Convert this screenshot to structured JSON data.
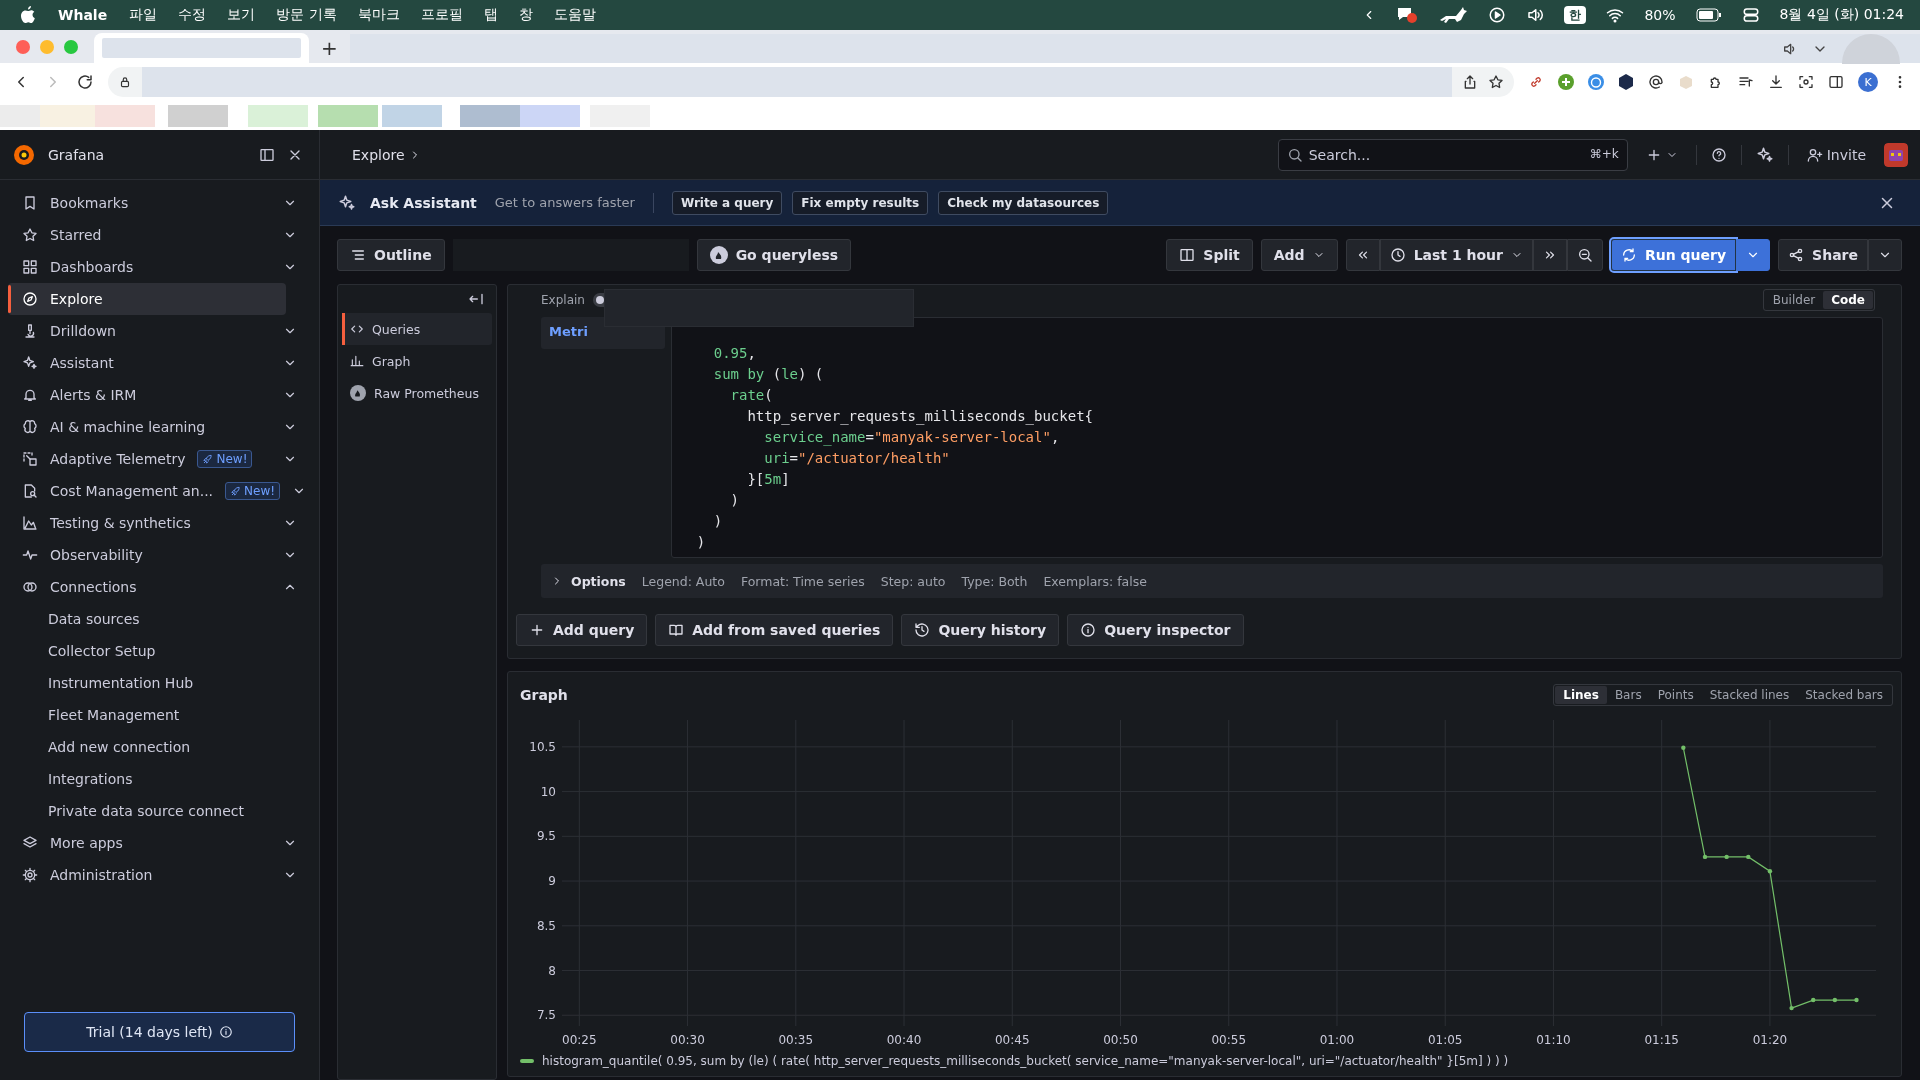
{
  "menubar": {
    "app": "Whale",
    "menus": [
      "파일",
      "수정",
      "보기",
      "방문 기록",
      "북마크",
      "프로필",
      "탭",
      "창",
      "도움말"
    ],
    "ime": "한",
    "battery": "80%",
    "clock": "8월 4일 (화) 01:24"
  },
  "browser": {
    "new_tab": "+",
    "profile": "K"
  },
  "header": {
    "breadcrumb": "Explore",
    "search": {
      "placeholder": "Search..."
    },
    "shortcut": "⌘+k",
    "invite": "Invite"
  },
  "sidebar": {
    "brand": "Grafana",
    "items": [
      {
        "label": "Bookmarks",
        "selected": false,
        "expanded": false
      },
      {
        "label": "Starred",
        "selected": false,
        "expanded": false
      },
      {
        "label": "Dashboards",
        "selected": false,
        "expanded": false
      },
      {
        "label": "Explore",
        "selected": true
      },
      {
        "label": "Drilldown",
        "selected": false,
        "expanded": false
      },
      {
        "label": "Assistant",
        "selected": false,
        "expanded": false
      },
      {
        "label": "Alerts & IRM",
        "selected": false,
        "expanded": false
      },
      {
        "label": "AI & machine learning",
        "selected": false,
        "expanded": false
      },
      {
        "label": "Adaptive Telemetry",
        "badge": "New!",
        "selected": false,
        "expanded": false
      },
      {
        "label": "Cost Management an...",
        "badge": "New!",
        "selected": false,
        "expanded": false
      },
      {
        "label": "Testing & synthetics",
        "selected": false,
        "expanded": false
      },
      {
        "label": "Observability",
        "selected": false,
        "expanded": false
      },
      {
        "label": "Connections",
        "selected": false,
        "expanded": true,
        "children": [
          {
            "label": "Data sources",
            "selected": false
          },
          {
            "label": "Collector Setup",
            "selected": false
          },
          {
            "label": "Instrumentation Hub",
            "selected": false
          },
          {
            "label": "Fleet Management",
            "selected": false
          },
          {
            "label": "Add new connection",
            "selected": false
          },
          {
            "label": "Integrations",
            "selected": false
          },
          {
            "label": "Private data source connect",
            "selected": false
          }
        ]
      },
      {
        "label": "More apps",
        "selected": false,
        "expanded": false
      },
      {
        "label": "Administration",
        "selected": false,
        "expanded": false
      }
    ],
    "trial": "Trial (14 days left)"
  },
  "banner": {
    "title": "Ask Assistant",
    "hint": "Get to answers faster",
    "actions": [
      "Write a query",
      "Fix empty results",
      "Check my datasources"
    ]
  },
  "toolbar": {
    "outline": "Outline",
    "queryless": "Go queryless",
    "split": "Split",
    "add": "Add",
    "time_range": "Last 1 hour",
    "run": "Run query",
    "share": "Share"
  },
  "outline": {
    "items": [
      {
        "label": "Queries",
        "selected": true
      },
      {
        "label": "Graph",
        "selected": false
      },
      {
        "label": "Raw Prometheus",
        "selected": false
      }
    ]
  },
  "query": {
    "explain": "Explain",
    "explain_on": false,
    "metric_tab": "Metri",
    "modes": [
      {
        "label": "Builder",
        "selected": false
      },
      {
        "label": "Code",
        "selected": true
      }
    ],
    "code": [
      {
        "children": [
          {
            "tokens": [
              {
                "kind": "num",
                "text": "0.95"
              },
              {
                "kind": "plain",
                "text": ","
              }
            ]
          },
          {
            "tokens": [
              {
                "kind": "fn",
                "text": "sum by"
              },
              {
                "kind": "plain",
                "text": " ("
              },
              {
                "kind": "fn",
                "text": "le"
              },
              {
                "kind": "plain",
                "text": ") ("
              }
            ],
            "children": [
              {
                "tokens": [
                  {
                    "kind": "fn",
                    "text": "rate"
                  },
                  {
                    "kind": "plain",
                    "text": "("
                  }
                ],
                "children": [
                  {
                    "tokens": [
                      {
                        "kind": "plain",
                        "text": "http_server_requests_milliseconds_bucket{"
                      }
                    ],
                    "children": [
                      {
                        "tokens": [
                          {
                            "kind": "fn",
                            "text": "service_name"
                          },
                          {
                            "kind": "plain",
                            "text": "="
                          },
                          {
                            "kind": "str",
                            "text": "\"manyak-server-local\""
                          },
                          {
                            "kind": "plain",
                            "text": ","
                          }
                        ]
                      },
                      {
                        "tokens": [
                          {
                            "kind": "fn",
                            "text": "uri"
                          },
                          {
                            "kind": "plain",
                            "text": "="
                          },
                          {
                            "kind": "str",
                            "text": "\"/actuator/health\""
                          }
                        ]
                      }
                    ]
                  },
                  {
                    "tokens": [
                      {
                        "kind": "plain",
                        "text": "}["
                      },
                      {
                        "kind": "fn",
                        "text": "5m"
                      },
                      {
                        "kind": "plain",
                        "text": "]"
                      }
                    ]
                  }
                ]
              },
              {
                "tokens": [
                  {
                    "kind": "plain",
                    "text": ")"
                  }
                ]
              }
            ]
          },
          {
            "tokens": [
              {
                "kind": "plain",
                "text": ")"
              }
            ]
          }
        ]
      },
      {
        "tokens": [
          {
            "kind": "plain",
            "text": ")"
          }
        ]
      }
    ],
    "options_label": "Options",
    "options": [
      "Legend: Auto",
      "Format: Time series",
      "Step: auto",
      "Type: Both",
      "Exemplars: false"
    ],
    "actions": [
      "Add query",
      "Add from saved queries",
      "Query history",
      "Query inspector"
    ]
  },
  "graph": {
    "title": "Graph",
    "modes": [
      {
        "label": "Lines",
        "selected": true
      },
      {
        "label": "Bars",
        "selected": false
      },
      {
        "label": "Points",
        "selected": false
      },
      {
        "label": "Stacked lines",
        "selected": false
      },
      {
        "label": "Stacked bars",
        "selected": false
      }
    ],
    "chart_data": {
      "type": "line",
      "grid": true,
      "x": [
        76,
        77,
        78,
        79,
        80,
        81,
        82,
        83,
        84
      ],
      "xlim": [
        24.2,
        84.9
      ],
      "ylim": [
        7.38,
        10.8
      ],
      "xticks": [
        {
          "value": 25,
          "label": "00:25"
        },
        {
          "value": 30,
          "label": "00:30"
        },
        {
          "value": 35,
          "label": "00:35"
        },
        {
          "value": 40,
          "label": "00:40"
        },
        {
          "value": 45,
          "label": "00:45"
        },
        {
          "value": 50,
          "label": "00:50"
        },
        {
          "value": 55,
          "label": "00:55"
        },
        {
          "value": 60,
          "label": "01:00"
        },
        {
          "value": 65,
          "label": "01:05"
        },
        {
          "value": 70,
          "label": "01:10"
        },
        {
          "value": 75,
          "label": "01:15"
        },
        {
          "value": 80,
          "label": "01:20"
        }
      ],
      "yticks": [
        7.5,
        8,
        8.5,
        9,
        9.5,
        10,
        10.5
      ],
      "series": [
        {
          "name": "histogram_quantile( 0.95, sum by (le) ( rate( http_server_requests_milliseconds_bucket( service_name=\"manyak-server-local\", uri=\"/actuator/health\" }[5m] ) ) )",
          "color": "#73bf69",
          "values": [
            10.49,
            9.27,
            9.27,
            9.27,
            9.11,
            7.58,
            7.67,
            7.67,
            7.67
          ]
        }
      ]
    }
  }
}
